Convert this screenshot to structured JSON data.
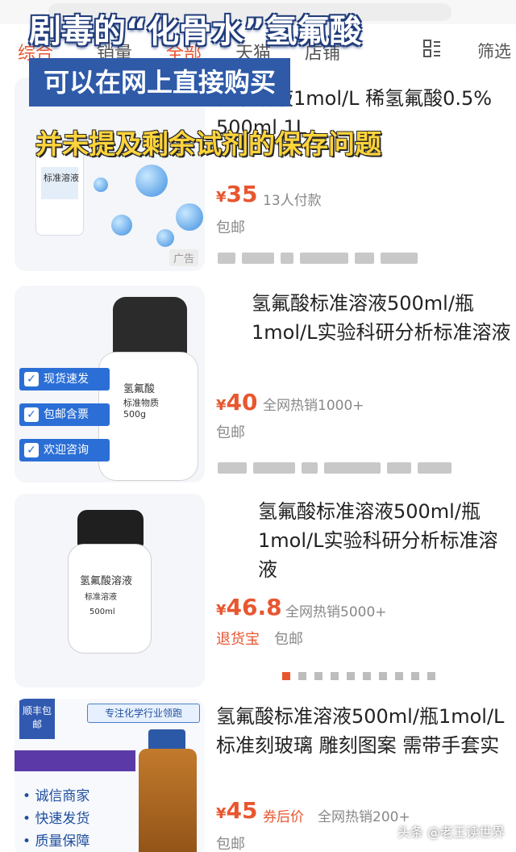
{
  "header": {
    "search_text": "",
    "filters": [
      "综合",
      "销量",
      "全部",
      "天猫",
      "店铺"
    ],
    "filter_screen": "筛选"
  },
  "overlay": {
    "line1": "剧毒的“化骨水”氢氟酸",
    "line2": "可以在网上直接购买",
    "line3": "并未提及剩余试剂的保存问题"
  },
  "products": [
    {
      "title": "标准溶液1mol/L 稀氢氟酸0.5% 500ml 1L",
      "price_yen": "¥",
      "price": "35",
      "sales": "13人付款",
      "shipping": "包邮",
      "ad_label": "广告",
      "thumb_label": "标准溶液"
    },
    {
      "title": "氢氟酸标准溶液500ml/瓶 1mol/L实验科研分析标准溶液",
      "price_yen": "¥",
      "price": "40",
      "sales": "全网热销1000+",
      "shipping": "包邮",
      "badges": [
        "现货速发",
        "包邮含票",
        "欢迎咨询"
      ],
      "bottle_name": "氢氟酸",
      "bottle_sub": "标准物质",
      "bottle_weight": "500g"
    },
    {
      "title": "氢氟酸标准溶液500ml/瓶 1mol/L实验科研分析标准溶液",
      "price_yen": "¥",
      "price": "46.8",
      "sales": "全网热销5000+",
      "return_tag": "退货宝",
      "shipping": "包邮",
      "bottle_name": "氢氟酸溶液",
      "bottle_sub": "标准溶液",
      "bottle_vol": "500ml"
    },
    {
      "title": "氢氟酸标准溶液500ml/瓶1mol/L 标准刻玻璃 雕刻图案 需带手套实",
      "price_yen": "¥",
      "price": "45",
      "coupon": "券后价",
      "sales": "全网热销200+",
      "shipping": "包邮",
      "ribbon": "顺丰包邮",
      "header_banner": "专注化学行业领跑",
      "features": [
        "诚信商家",
        "快速发货",
        "质量保障"
      ]
    }
  ],
  "watermark": "头条 @老王读世界",
  "colors": {
    "accent": "#e8562f",
    "banner_blue": "#2e5aa8",
    "banner_yellow": "#ffd43a"
  }
}
